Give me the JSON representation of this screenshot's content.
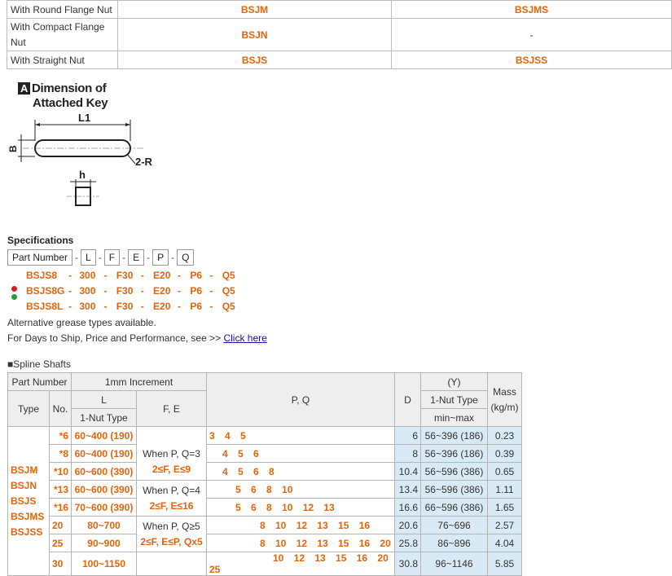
{
  "top_table": [
    {
      "desc": "With Round Flange Nut",
      "a": "BSJM",
      "b": "BSJMS"
    },
    {
      "desc": "With Compact Flange Nut",
      "a": "BSJN",
      "b": "-"
    },
    {
      "desc": "With Straight Nut",
      "a": "BSJS",
      "b": "BSJSS"
    }
  ],
  "key": {
    "badge": "A",
    "title_line1": "Dimension of",
    "title_line2": "Attached Key",
    "l1": "L1",
    "b": "B",
    "r": "2-R",
    "h": "h"
  },
  "spec": {
    "title": "Specifications",
    "boxes": [
      "Part Number",
      "L",
      "F",
      "E",
      "P",
      "Q"
    ],
    "lines": [
      [
        "BSJS8",
        "300",
        "F30",
        "E20",
        "P6",
        "Q5"
      ],
      [
        "BSJS8G",
        "300",
        "F30",
        "E20",
        "P6",
        "Q5"
      ],
      [
        "BSJS8L",
        "300",
        "F30",
        "E20",
        "P6",
        "Q5"
      ]
    ],
    "dot_colors": [
      "#d42020",
      "#2a9a3a"
    ],
    "note1": "Alternative grease types available.",
    "note2_prefix": "For Days to Ship, Price and Performance, see >> ",
    "note2_link": "Click here"
  },
  "spline": {
    "label": "■Spline Shafts",
    "headers": {
      "part_number": "Part Number",
      "increment": "1mm Increment",
      "y": "(Y)",
      "mass": "Mass",
      "mass_unit": "(kg/m)",
      "type": "Type",
      "no": "No.",
      "l": "L",
      "fe": "F, E",
      "pq": "P, Q",
      "d": "D",
      "one_nut": "1-Nut Type",
      "l_sub": "1-Nut Type",
      "minmax": "min~max"
    },
    "types": [
      "BSJM",
      "BSJN",
      "BSJS",
      "BSJMS",
      "BSJSS"
    ],
    "fe_text": [
      "When P, Q=3",
      "2≤F, E≤9",
      "When P, Q=4",
      "2≤F, E≤16",
      "When P, Q≥5",
      "2≤F, E≤P, Qx5"
    ],
    "rows": [
      {
        "no": "*6",
        "l": "60~400 (190)",
        "pq": "3 4 5",
        "pq_indent": 0,
        "d": "6",
        "y": "56~396 (186)",
        "mass": "0.23"
      },
      {
        "no": "*8",
        "l": "60~400 (190)",
        "pq": "4 5 6",
        "pq_indent": 16,
        "d": "8",
        "y": "56~396 (186)",
        "mass": "0.39"
      },
      {
        "no": "*10",
        "l": "60~600 (390)",
        "pq": "4 5 6 8",
        "pq_indent": 16,
        "d": "10.4",
        "y": "56~596 (386)",
        "mass": "0.65"
      },
      {
        "no": "*13",
        "l": "60~600 (390)",
        "pq": "5 6 8 10",
        "pq_indent": 32,
        "d": "13.4",
        "y": "56~596 (386)",
        "mass": "1.11"
      },
      {
        "no": "*16",
        "l": "70~600 (390)",
        "pq": "5 6 8 10 12 13",
        "pq_indent": 32,
        "d": "16.6",
        "y": "66~596 (386)",
        "mass": "1.65"
      },
      {
        "no": "20",
        "l": "80~700",
        "pq": "8 10 12 13 15 16",
        "pq_indent": 62,
        "d": "20.6",
        "y": "76~696",
        "mass": "2.57"
      },
      {
        "no": "25",
        "l": "90~900",
        "pq": "8 10 12 13 15 16 20",
        "pq_indent": 62,
        "d": "25.8",
        "y": "86~896",
        "mass": "4.04"
      },
      {
        "no": "30",
        "l": "100~1150",
        "pq": "10 12 13 15 16 20 25",
        "pq_indent": 78,
        "d": "30.8",
        "y": "96~1146",
        "mass": "5.85"
      }
    ]
  }
}
